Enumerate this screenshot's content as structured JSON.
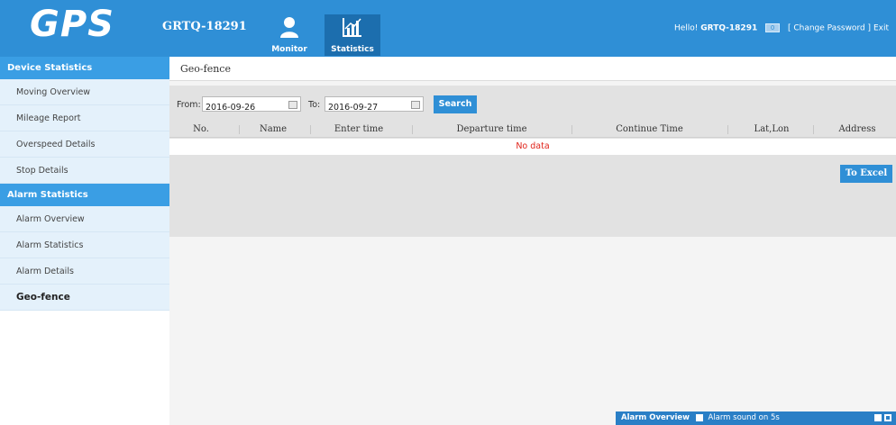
{
  "header": {
    "logo": "GPS",
    "device_id": "GRTQ-18291",
    "nav": [
      {
        "label": "Monitor",
        "icon": "user-icon"
      },
      {
        "label": "Statistics",
        "icon": "bar-chart-icon"
      }
    ],
    "hello_label": "Hello!",
    "hello_user": "GRTQ-18291",
    "message_count": "0",
    "change_password": "[ Change Password ]",
    "exit": "Exit"
  },
  "sidebar": {
    "groups": [
      {
        "title": "Device Statistics",
        "items": [
          "Moving Overview",
          "Mileage Report",
          "Overspeed Details",
          "Stop Details"
        ]
      },
      {
        "title": "Alarm Statistics",
        "items": [
          "Alarm Overview",
          "Alarm Statistics",
          "Alarm Details",
          "Geo-fence"
        ]
      }
    ],
    "active_item": "Geo-fence"
  },
  "main": {
    "breadcrumb": "Geo-fence",
    "filter": {
      "from_label": "From:",
      "from_value": "2016-09-26",
      "to_label": "To:",
      "to_value": "2016-09-27",
      "search_label": "Search"
    },
    "table": {
      "columns": [
        "No.",
        "Name",
        "Enter time",
        "Departure time",
        "Continue Time",
        "Lat,Lon",
        "Address"
      ],
      "empty_text": "No data"
    },
    "export_label": "To Excel"
  },
  "alarm_bar": {
    "title": "Alarm Overview",
    "sound_label": "Alarm sound on 5s"
  },
  "colors": {
    "header_bg": "#2f8fd6",
    "accent": "#2f8fd6",
    "no_data": "#e0231a"
  }
}
